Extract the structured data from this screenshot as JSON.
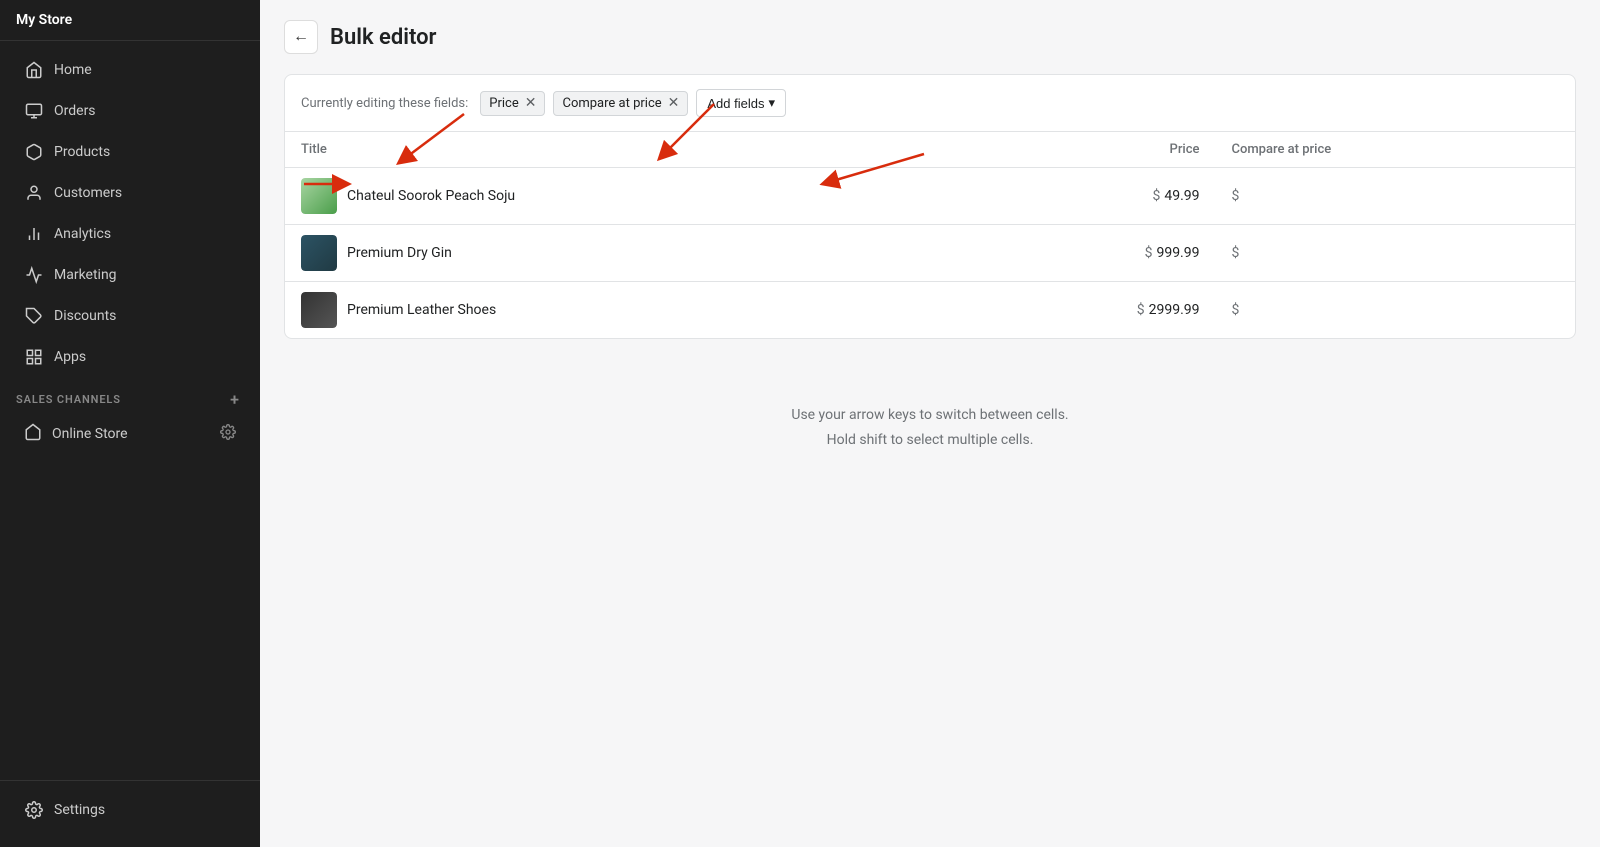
{
  "sidebar": {
    "store": "My Store",
    "nav": [
      {
        "id": "home",
        "label": "Home",
        "icon": "home"
      },
      {
        "id": "orders",
        "label": "Orders",
        "icon": "orders"
      },
      {
        "id": "products",
        "label": "Products",
        "icon": "products"
      },
      {
        "id": "customers",
        "label": "Customers",
        "icon": "customers"
      },
      {
        "id": "analytics",
        "label": "Analytics",
        "icon": "analytics"
      },
      {
        "id": "marketing",
        "label": "Marketing",
        "icon": "marketing"
      },
      {
        "id": "discounts",
        "label": "Discounts",
        "icon": "discounts"
      },
      {
        "id": "apps",
        "label": "Apps",
        "icon": "apps"
      }
    ],
    "sales_channels_label": "SALES CHANNELS",
    "online_store": "Online Store",
    "settings": "Settings"
  },
  "header": {
    "back_label": "←",
    "title": "Bulk editor"
  },
  "fields_bar": {
    "label": "Currently editing these fields:",
    "fields": [
      {
        "id": "price",
        "label": "Price"
      },
      {
        "id": "compare_at_price",
        "label": "Compare at price"
      }
    ],
    "add_button": "Add fields"
  },
  "table": {
    "columns": [
      {
        "id": "title",
        "label": "Title"
      },
      {
        "id": "price",
        "label": "Price"
      },
      {
        "id": "compare_at_price",
        "label": "Compare at price"
      }
    ],
    "rows": [
      {
        "id": 1,
        "title": "Chateul Soorok Peach Soju",
        "price": "49.99",
        "compare_at_price": ""
      },
      {
        "id": 2,
        "title": "Premium Dry Gin",
        "price": "999.99",
        "compare_at_price": ""
      },
      {
        "id": 3,
        "title": "Premium Leather Shoes",
        "price": "2999.99",
        "compare_at_price": ""
      }
    ]
  },
  "hint": {
    "line1": "Use your arrow keys to switch between cells.",
    "line2": "Hold shift to select multiple cells."
  }
}
